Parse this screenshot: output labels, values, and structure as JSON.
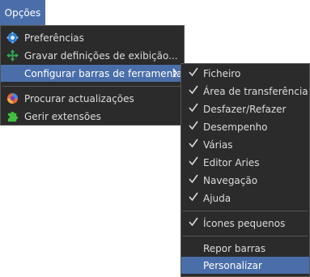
{
  "menubar": {
    "options_label": "Opções"
  },
  "main_menu": {
    "items": [
      {
        "label": "Preferências",
        "icon": "gear-icon"
      },
      {
        "label": "Gravar definições de exibição...",
        "icon": "move-arrows-icon"
      },
      {
        "label": "Configurar barras de ferramentas",
        "has_submenu": true
      },
      {
        "label": "Procurar actualizações",
        "icon": "update-globe-icon"
      },
      {
        "label": "Gerir extensões",
        "icon": "puzzle-icon"
      }
    ]
  },
  "toolbars_submenu": {
    "items": [
      {
        "label": "Ficheiro",
        "checked": true
      },
      {
        "label": "Área de transferência",
        "checked": true
      },
      {
        "label": "Desfazer/Refazer",
        "checked": true
      },
      {
        "label": "Desempenho",
        "checked": true
      },
      {
        "label": "Várias",
        "checked": true
      },
      {
        "label": "Editor Aries",
        "checked": true
      },
      {
        "label": "Navegação",
        "checked": true
      },
      {
        "label": "Ajuda",
        "checked": true
      },
      {
        "label": "Ícones pequenos",
        "checked": true
      },
      {
        "label": "Repor barras",
        "checked": false
      },
      {
        "label": "Personalizar",
        "checked": false,
        "highlighted": true
      }
    ]
  },
  "colors": {
    "menu_bg": "#2b2b2b",
    "highlight": "#4a6ea9",
    "text": "#dcdcdc"
  }
}
